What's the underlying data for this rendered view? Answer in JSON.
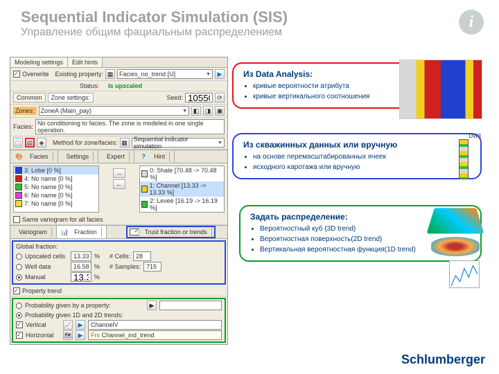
{
  "title": "Sequential Indicator Simulation (SIS)",
  "subtitle": "Управление общим фациальным распределением",
  "info_glyph": "i",
  "logo": "Schlumberger",
  "panel": {
    "tabs_top": [
      "Modeling settings",
      "Edit hints"
    ],
    "row_overwrite": {
      "chk": "Overwrite",
      "label": "Existing property:",
      "value": "Facies_no_trend [U]",
      "arrow": "▶"
    },
    "row_status": {
      "label": "Status:",
      "value": "Is upscaled"
    },
    "row2_tabs": {
      "common": "Common",
      "zone": "Zone settings:"
    },
    "seed": {
      "label": "Seed:",
      "value": "10550"
    },
    "zones": {
      "label": "Zones:",
      "value": "ZoneA (Main_pay)"
    },
    "facies_row": {
      "label": "Facies:",
      "text": "No conditioning to facies. The zone is modeled in one single operation."
    },
    "method": {
      "label": "Method for zone/facies:",
      "value": "Sequential indicator simulation"
    },
    "innertabs": [
      "Facies",
      "Settings",
      "Expert",
      "Hint"
    ],
    "left_list": [
      {
        "color": "#2040d0",
        "text": "3: Lobe [0 %]"
      },
      {
        "color": "#d02020",
        "text": "4: No name [0 %]"
      },
      {
        "color": "#30c030",
        "text": "5: No name [0 %]"
      },
      {
        "color": "#e040d0",
        "text": "6: No name [0 %]"
      },
      {
        "color": "#f0e030",
        "text": "7: No name [0 %]"
      }
    ],
    "right_list": [
      {
        "color": "#d8d8d8",
        "text": "0: Shale [70.48 -> 70.48 %]"
      },
      {
        "color": "#f0d020",
        "text": "1: Channel [13.33 -> 13.33 %]"
      },
      {
        "color": "#30c030",
        "text": "2: Levee [16.19 -> 16.19 %]"
      }
    ],
    "same_variogram": "Same variogram for all facies",
    "vftabs": [
      "Variogram",
      "Fraction"
    ],
    "trust": "Trust fraction or trends",
    "global_fraction": {
      "label": "Global fraction:",
      "rows": [
        {
          "name": "Upscaled cells",
          "val": "13.33",
          "extra_lbl": "# Cells:",
          "extra_val": "28"
        },
        {
          "name": "Well data",
          "val": "16.58",
          "extra_lbl": "# Samples:",
          "extra_val": "715"
        },
        {
          "name": "Manual",
          "val": "13.33",
          "extra_lbl": "",
          "extra_val": ""
        }
      ],
      "pct": "%"
    },
    "prop_trend": "Property trend",
    "prob_given_label": "Probability given by a property:",
    "prob_1d2d_label": "Probability given 1D and 2D trends:",
    "vertical": {
      "label": "Vertical",
      "value": "ChannelV"
    },
    "horizontal": {
      "label": "Horizontal",
      "value": "Channel_ind_trend"
    }
  },
  "callouts": {
    "red": {
      "title": "Из Data Analysis:",
      "items": [
        "кривые вероятности атрибута",
        "кривые вертикального соотношения"
      ]
    },
    "blue": {
      "title": "Из скважинных данных или вручную",
      "items": [
        "на основе перемасштабированных ячеек",
        "исходного каротажа или вручную"
      ]
    },
    "green": {
      "title": "Задать распределение:",
      "items": [
        "Вероятностный куб (3D trend)",
        "Вероятностная поверхность(2D trend)",
        "Вертикальная вероятностная функция(1D trend)"
      ]
    }
  },
  "well_label": "DW3"
}
